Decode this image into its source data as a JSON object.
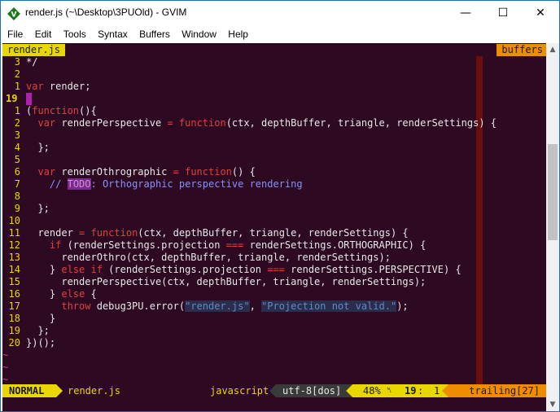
{
  "window": {
    "title": "render.js (~\\Desktop\\3PUOld) - GVIM",
    "minimize": "—",
    "maximize": "☐",
    "close": "✕"
  },
  "menu": [
    "File",
    "Edit",
    "Tools",
    "Syntax",
    "Buffers",
    "Window",
    "Help"
  ],
  "tabline": {
    "active": "render.js",
    "right": "buffers"
  },
  "colors": {
    "background": "#2d0a22",
    "line_number": "#e8d800",
    "keyword": "#e04040",
    "comment": "#8890ff",
    "colorcolumn": "#6a0d0d",
    "status_mode": "#e8d800",
    "status_trailing": "#f08c00"
  },
  "lines": [
    {
      "n": "3",
      "code": "*/"
    },
    {
      "n": "2",
      "code": ""
    },
    {
      "n": "1",
      "code": "var render;"
    },
    {
      "n": "19",
      "code": "",
      "current": true
    },
    {
      "n": "1",
      "code": "(function(){"
    },
    {
      "n": "2",
      "code": "  var renderPerspective = function(ctx, depthBuffer, triangle, renderSettings) {"
    },
    {
      "n": "3",
      "code": ""
    },
    {
      "n": "4",
      "code": "  };"
    },
    {
      "n": "5",
      "code": ""
    },
    {
      "n": "6",
      "code": "  var renderOthrographic = function() {"
    },
    {
      "n": "7",
      "code": "    // TODO: Orthographic perspective rendering"
    },
    {
      "n": "8",
      "code": ""
    },
    {
      "n": "9",
      "code": "  };"
    },
    {
      "n": "10",
      "code": ""
    },
    {
      "n": "11",
      "code": "  render = function(ctx, depthBuffer, triangle, renderSettings) {"
    },
    {
      "n": "12",
      "code": "    if (renderSettings.projection === renderSettings.ORTHOGRAPHIC) {"
    },
    {
      "n": "13",
      "code": "      renderOthro(ctx, depthBuffer, triangle, renderSettings);"
    },
    {
      "n": "14",
      "code": "    } else if (renderSettings.projection === renderSettings.PERSPECTIVE) {"
    },
    {
      "n": "15",
      "code": "      renderPerspective(ctx, depthBuffer, triangle, renderSettings);"
    },
    {
      "n": "16",
      "code": "    } else {"
    },
    {
      "n": "17",
      "code": "      throw debug3PU.error(\"render.js\", \"Projection not valid.\");"
    },
    {
      "n": "18",
      "code": "    }"
    },
    {
      "n": "19",
      "code": "  };"
    },
    {
      "n": "20",
      "code": "})();"
    }
  ],
  "tildes": [
    "~",
    "~",
    "~"
  ],
  "statusline": {
    "mode": "NORMAL",
    "filename": "render.js",
    "filetype": "javascript",
    "encoding": "utf-8[dos]",
    "percent": "48%",
    "ln_symbol": "␤",
    "line": "19",
    "col": "1",
    "trailing": "trailing[27]"
  }
}
